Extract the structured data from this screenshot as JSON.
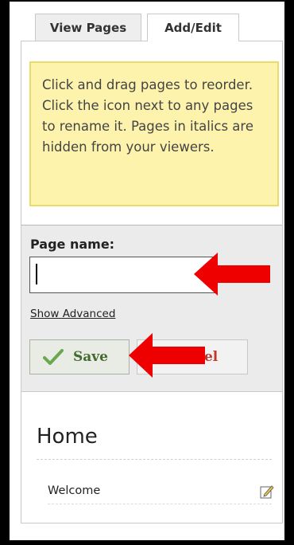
{
  "tabs": {
    "view_pages": "View Pages",
    "add_edit": "Add/Edit"
  },
  "note": {
    "text": "Click and drag pages to reorder. Click the icon next to any pages to rename it. Pages in italics are hidden from your viewers."
  },
  "form": {
    "page_name_label": "Page name:",
    "page_name_value": "",
    "show_advanced_label": "Show Advanced",
    "save_label": "Save",
    "cancel_label": "Cancel"
  },
  "pages": {
    "section_title": "Home",
    "items": [
      {
        "label": "Welcome"
      }
    ]
  },
  "icons": {
    "save": "checkmark-icon",
    "edit": "pencil-edit-icon",
    "annotation": "red-arrow-icon"
  },
  "colors": {
    "note_bg": "#fdf3ad",
    "save_text": "#446b2f",
    "cancel_text": "#c0392b",
    "arrow": "#ee0000"
  }
}
